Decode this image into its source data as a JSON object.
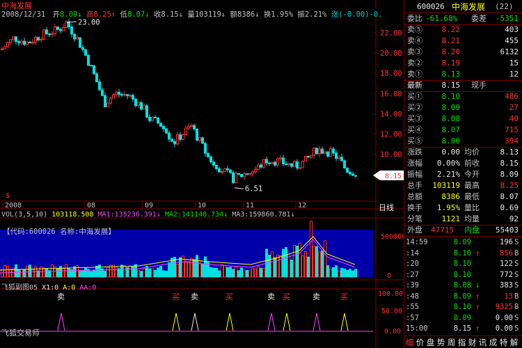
{
  "chart_header": {
    "date": "2008/12/31",
    "open_label": "开",
    "open": "8.09",
    "high_label": "高",
    "high": "8.25",
    "low_label": "低",
    "low": "8.07",
    "close_label": "收",
    "close": "8.15",
    "vol_label": "量",
    "vol": "103119",
    "amt_label": "额",
    "amt": "8386",
    "turn_label": "换",
    "turn": "1.95%",
    "amp_label": "振",
    "amp": "2.21%",
    "chg_label": "涨",
    "chg": "(-0.00)-0."
  },
  "stock_name_tag": "中海发展",
  "price_axis": [
    "22.00",
    "20.00",
    "18.00",
    "16.00",
    "14.00",
    "12.00",
    "10.00",
    "8.15"
  ],
  "max_marker": "23.00",
  "min_marker": "6.51",
  "month_labels": [
    "2008",
    "08",
    "09",
    "10",
    "11",
    "12"
  ],
  "period_label": "日线",
  "vol_header": {
    "title": "VOL(3,5,10)",
    "vol": "103118.508",
    "ma1_label": "MA1:",
    "ma1": "135236.391",
    "ma2_label": "MA2:",
    "ma2": "141148.734",
    "ma3_label": "MA3:",
    "ma3": "159860.781"
  },
  "vol_info": "【代码:600026 名称:中海发展】",
  "vol_axis": [
    "500000",
    "0"
  ],
  "ind_header": {
    "title": "飞狐副图05",
    "x1": "X1:0",
    "a": "A:0",
    "aa": "AA:0"
  },
  "ind_axis": [
    "100.00",
    "50.00",
    "0.00"
  ],
  "ind_footer": "飞狐交易师",
  "signals": [
    "卖",
    "买",
    "卖",
    "买",
    "卖",
    "买",
    "卖",
    "买"
  ],
  "panel": {
    "code": "600026",
    "name": "中海发展",
    "count": "(22)",
    "webi_label": "委比",
    "webi": "-61.68%",
    "wecha_label": "委差",
    "wecha": "-5351",
    "asks": [
      {
        "label": "卖⑤",
        "price": "8.22",
        "vol": "403"
      },
      {
        "label": "卖④",
        "price": "8.21",
        "vol": "455"
      },
      {
        "label": "卖③",
        "price": "8.20",
        "vol": "6132"
      },
      {
        "label": "卖②",
        "price": "8.19",
        "vol": "15"
      },
      {
        "label": "卖①",
        "price": "8.13",
        "vol": "12"
      }
    ],
    "last_label": "最新",
    "last": "8.15",
    "cur_label": "现手",
    "bids": [
      {
        "label": "买①",
        "price": "8.10",
        "vol": "486"
      },
      {
        "label": "买②",
        "price": "8.09",
        "vol": "27"
      },
      {
        "label": "买③",
        "price": "8.08",
        "vol": "40"
      },
      {
        "label": "买④",
        "price": "8.07",
        "vol": "715"
      },
      {
        "label": "买⑤",
        "price": "8.06",
        "vol": "394"
      }
    ],
    "stats": [
      {
        "l1": "涨跌",
        "v1": "0.00",
        "l2": "均价",
        "v2": "8.13",
        "c2": "white"
      },
      {
        "l1": "涨幅",
        "v1": "0.00%",
        "l2": "前收",
        "v2": "8.15",
        "c2": "white"
      },
      {
        "l1": "振幅",
        "v1": "2.21%",
        "l2": "今开",
        "v2": "8.09",
        "c2": "white"
      },
      {
        "l1": "总手",
        "v1": "103119",
        "l2": "最高",
        "v2": "8.25",
        "c2": "red"
      },
      {
        "l1": "总额",
        "v1": "8386",
        "l2": "最低",
        "v2": "8.07",
        "c2": "white"
      },
      {
        "l1": "换手",
        "v1": "1.95%",
        "l2": "量比",
        "v2": "0.69",
        "c2": "white"
      },
      {
        "l1": "分笔",
        "v1": "1121",
        "l2": "均量",
        "v2": "92",
        "c2": "white"
      }
    ],
    "outer_label": "外盘",
    "outer": "47715",
    "inner_label": "内盘",
    "inner": "55403",
    "ticks": [
      {
        "t": "14:59",
        "p": "8.09",
        "a": "",
        "v": "196",
        "s": "S"
      },
      {
        "t": ":14",
        "p": "8.10",
        "a": "↑",
        "v": "856",
        "s": "B"
      },
      {
        "t": ":20",
        "p": "8.10",
        "a": "",
        "v": "122",
        "s": "S"
      },
      {
        "t": ":27",
        "p": "8.10",
        "a": "",
        "v": "772",
        "s": "S"
      },
      {
        "t": ":39",
        "p": "8.08",
        "a": "↓",
        "v": "383",
        "s": "S"
      },
      {
        "t": ":48",
        "p": "8.09",
        "a": "↑",
        "v": "13",
        "s": "B"
      },
      {
        "t": ":55",
        "p": "8.10",
        "a": "↑",
        "v": "9325",
        "s": "B"
      },
      {
        "t": ":57",
        "p": "8.09",
        "a": "",
        "v": "0.00",
        "s": "S"
      },
      {
        "t": "15:00",
        "p": "8.15",
        "a": "↑",
        "v": "0.00",
        "s": "S"
      }
    ],
    "footer": [
      "细",
      "价",
      "盘",
      "势",
      "周",
      "指",
      "财",
      "讯",
      "成",
      "特",
      "解"
    ]
  },
  "colors": {
    "up": "#ff3030",
    "down": "#00e0e0",
    "bg": "#000000",
    "grid": "#800000",
    "vol_bg": "#0000a8"
  }
}
